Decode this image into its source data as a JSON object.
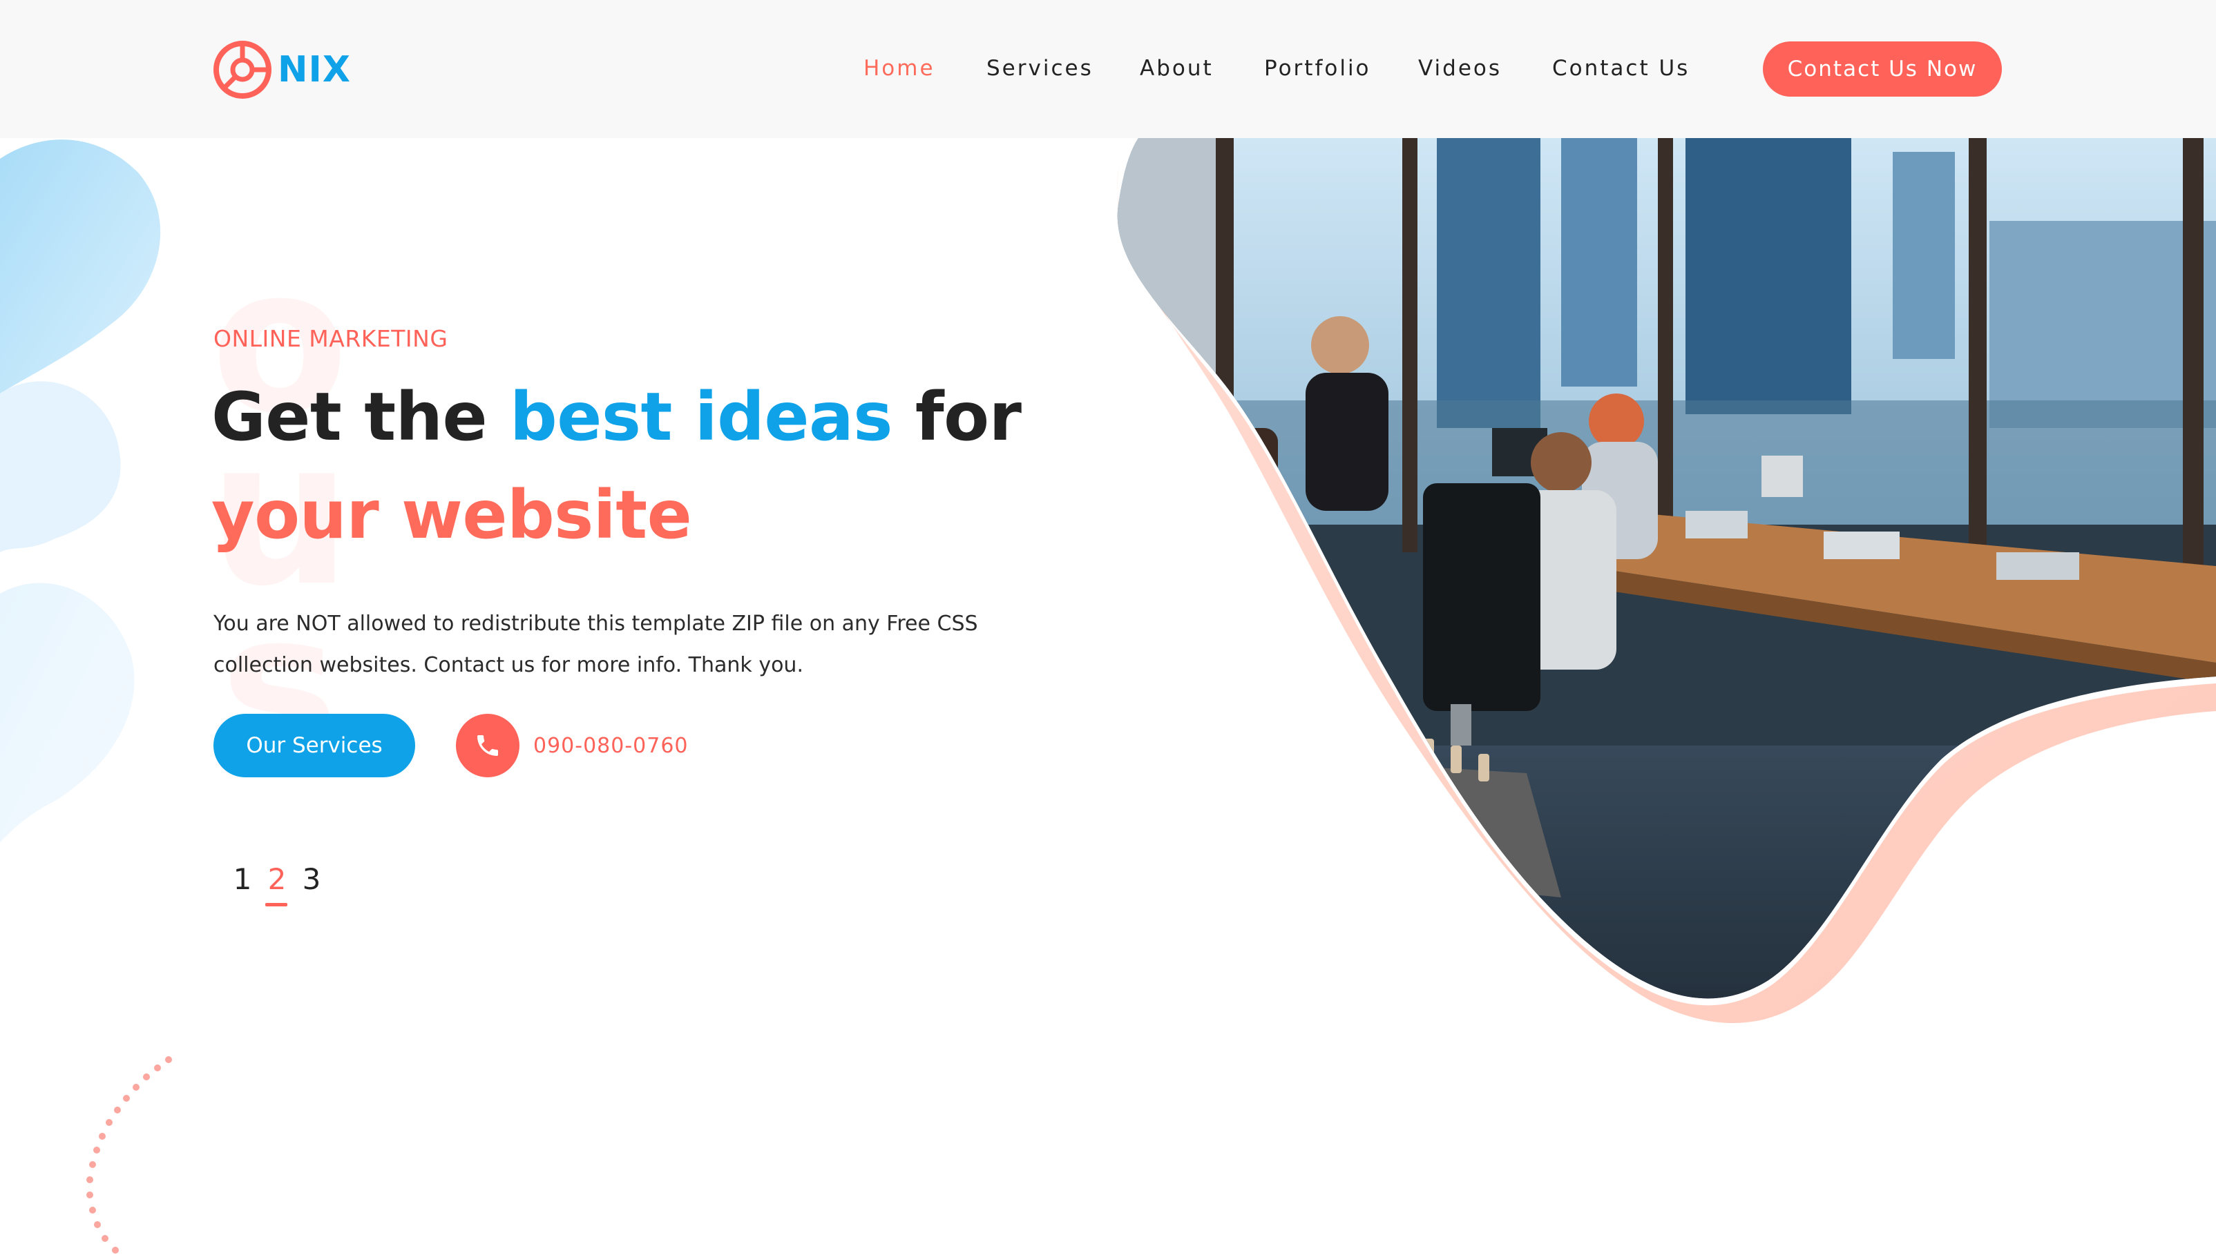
{
  "brand": {
    "name": "NIX",
    "logo_icon": "target-circle-icon",
    "colors": {
      "primary_blue": "#0fa2e8",
      "accent_coral": "#fe6259",
      "text_dark": "#232323"
    }
  },
  "nav": {
    "items": [
      {
        "label": "Home",
        "active": true
      },
      {
        "label": "Services",
        "active": false
      },
      {
        "label": "About",
        "active": false
      },
      {
        "label": "Portfolio",
        "active": false
      },
      {
        "label": "Videos",
        "active": false
      },
      {
        "label": "Contact Us",
        "active": false
      }
    ],
    "cta_label": "Contact Us Now"
  },
  "hero": {
    "watermark": "ous",
    "eyebrow": "ONLINE MARKETING",
    "title": {
      "part1": "Get the ",
      "highlight_blue": "best ideas",
      "part2": " for",
      "highlight_coral": "your website"
    },
    "description": "You are NOT allowed to redistribute this template ZIP file on any Free CSS collection websites. Contact us for more info. Thank you.",
    "primary_button": "Our Services",
    "phone": {
      "icon": "phone-icon",
      "number": "090-080-0760"
    },
    "image": "office-team-photo"
  },
  "pager": {
    "pages": [
      "1",
      "2",
      "3"
    ],
    "active": "2"
  }
}
